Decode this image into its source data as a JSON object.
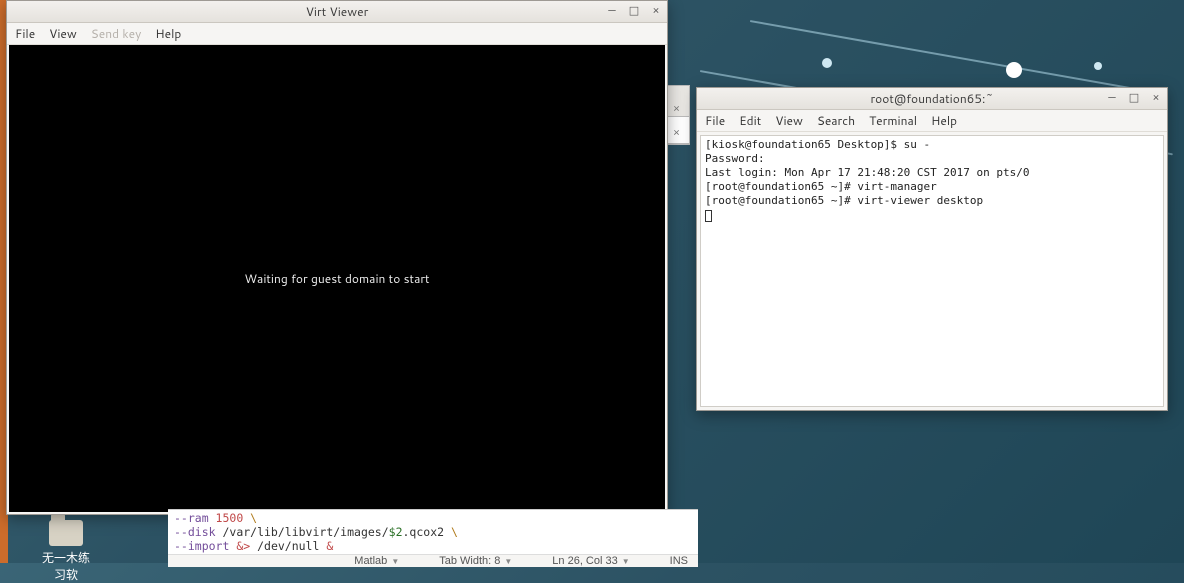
{
  "desktop": {
    "decor_present": true,
    "folder_label": "无一木练习软"
  },
  "virt": {
    "title": "Virt Viewer",
    "menus": {
      "file": "File",
      "view": "View",
      "sendkey": "Send key",
      "help": "Help"
    },
    "body_text": "Waiting for guest domain to start"
  },
  "terminal": {
    "title": "root@foundation65:~",
    "menus": {
      "file": "File",
      "edit": "Edit",
      "view": "View",
      "search": "Search",
      "terminal": "Terminal",
      "help": "Help"
    },
    "lines": [
      "[kiosk@foundation65 Desktop]$ su -",
      "Password:",
      "Last login: Mon Apr 17 21:48:20 CST 2017 on pts/0",
      "[root@foundation65 ~]# virt-manager",
      "[root@foundation65 ~]# virt-viewer desktop"
    ]
  },
  "editor": {
    "lines_html": [
      {
        "opt": "--ram ",
        "num": "1500 ",
        "esc": "\\"
      },
      {
        "opt": "--disk ",
        "path": "/var/lib/libvirt/images/",
        "var": "$2",
        "rest": ".qcox2 ",
        "esc": "\\"
      },
      {
        "opt": "--import ",
        "amp": "&> ",
        "path": "/dev/null ",
        "amp2": "&"
      }
    ],
    "status": {
      "lang": "Matlab",
      "tabwidth": "Tab Width: 8",
      "pos": "Ln 26, Col 33",
      "mode": "INS"
    }
  }
}
